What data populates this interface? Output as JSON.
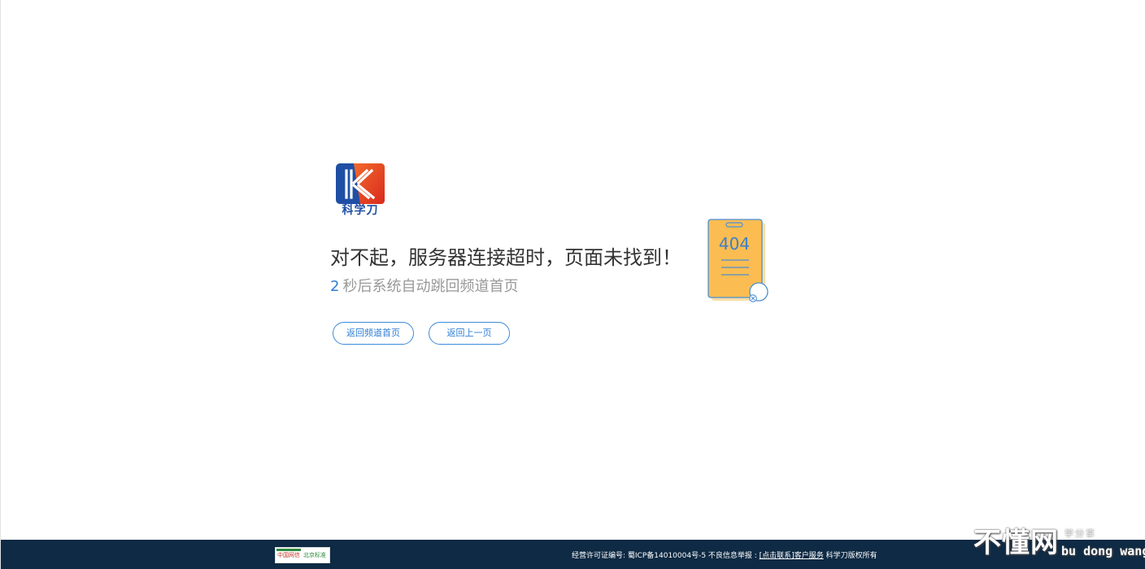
{
  "brand": {
    "logo_text": "科学刀",
    "colors": {
      "logo_blue": "#1f4fa5",
      "logo_red": "#e8402a",
      "accent": "#2e7ed4",
      "footer_bg": "#0e2a44"
    }
  },
  "error": {
    "title": "对不起，服务器连接超时，页面未找到！",
    "countdown": "2",
    "redirect_text": "秒后系统自动跳回频道首页"
  },
  "buttons": {
    "home_label": "返回频道首页",
    "back_label": "返回上一页"
  },
  "illustration": {
    "code": "404",
    "icons": [
      "clipboard-icon",
      "magnifier-icon"
    ]
  },
  "footer": {
    "badge_left": "中国网信",
    "badge_right": "北京标准",
    "license_text": "经营许可证编号: 蜀ICP备14010004号-5 不良信息举报 :",
    "report_link": "[点击联系]",
    "service_link": "客户服务",
    "copyright": "科学刀版权所有"
  },
  "watermark": {
    "big": "不懂网",
    "small": "学分享",
    "pinyin": "bu dong wang"
  }
}
